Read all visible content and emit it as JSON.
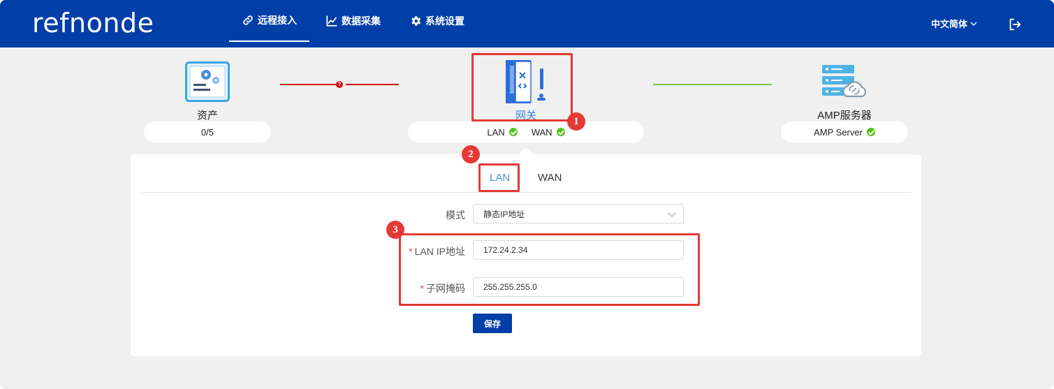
{
  "app": {
    "logo": "refnonde"
  },
  "nav": [
    {
      "label": "远程接入",
      "icon": "link-icon",
      "active": true
    },
    {
      "label": "数据采集",
      "icon": "chart-icon",
      "active": false
    },
    {
      "label": "系统设置",
      "icon": "gear-icon",
      "active": false
    }
  ],
  "header": {
    "language": "中文简体"
  },
  "topology": {
    "asset": {
      "label": "资产",
      "status": "0/5"
    },
    "gateway": {
      "label": "网关",
      "lan": "LAN",
      "wan": "WAN"
    },
    "server": {
      "label": "AMP服务器",
      "status": "AMP Server"
    }
  },
  "annotations": [
    "1",
    "2",
    "3"
  ],
  "tabs": [
    {
      "label": "LAN",
      "active": true
    },
    {
      "label": "WAN",
      "active": false
    }
  ],
  "form": {
    "mode_label": "模式",
    "mode_value": "静态IP地址",
    "ip_label": "LAN IP地址",
    "ip_value": "172.24.2.34",
    "mask_label": "子网掩码",
    "mask_value": "255.255.255.0",
    "required_mark": "*",
    "save_label": "保存"
  },
  "colors": {
    "header": "#003ea8",
    "accent": "#4a90d9",
    "error": "#d01010",
    "ok": "#52c41a",
    "annotation": "#e53935"
  }
}
